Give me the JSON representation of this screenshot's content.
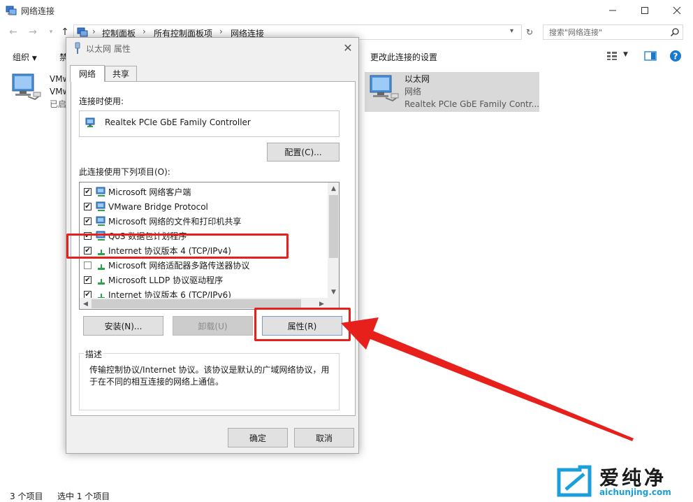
{
  "window": {
    "title": "网络连接"
  },
  "address": {
    "crumbs": [
      "控制面板",
      "所有控制面板项",
      "网络连接"
    ],
    "search_placeholder": "搜索\"网络连接\""
  },
  "commandbar": {
    "organize": "组织",
    "organize_partial": "禁",
    "change_settings": "更改此连接的设置"
  },
  "items": [
    {
      "line1": "VMw",
      "line2": "VMw",
      "line3": "已启"
    },
    {
      "line1": "以太网",
      "line2": "网络",
      "line3": "Realtek PCIe GbE Family Contr..."
    }
  ],
  "status": {
    "count": "3 个项目",
    "selected": "选中 1 个项目"
  },
  "dialog": {
    "title": "以太网 属性",
    "tabs": [
      "网络",
      "共享"
    ],
    "connect_using_label": "连接时使用:",
    "adapter_name": "Realtek PCIe GbE Family Controller",
    "configure_button": "配置(C)...",
    "items_label": "此连接使用下列项目(O):",
    "components": [
      {
        "label": "Microsoft 网络客户端",
        "checked": true,
        "icon": "network-client-icon"
      },
      {
        "label": "VMware Bridge Protocol",
        "checked": true,
        "icon": "network-client-icon"
      },
      {
        "label": "Microsoft 网络的文件和打印机共享",
        "checked": true,
        "icon": "network-client-icon"
      },
      {
        "label": "QoS 数据包计划程序",
        "checked": true,
        "icon": "network-client-icon"
      },
      {
        "label": "Internet 协议版本 4 (TCP/IPv4)",
        "checked": true,
        "icon": "protocol-icon"
      },
      {
        "label": "Microsoft 网络适配器多路传送器协议",
        "checked": false,
        "icon": "protocol-icon"
      },
      {
        "label": "Microsoft LLDP 协议驱动程序",
        "checked": true,
        "icon": "protocol-icon"
      },
      {
        "label": "Internet 协议版本 6 (TCP/IPv6)",
        "checked": true,
        "icon": "protocol-icon"
      }
    ],
    "install_button": "安装(N)...",
    "uninstall_button": "卸载(U)",
    "properties_button": "属性(R)",
    "description_title": "描述",
    "description_text": "传输控制协议/Internet 协议。该协议是默认的广域网络协议，用于在不同的相互连接的网络上通信。",
    "ok_button": "确定",
    "cancel_button": "取消"
  },
  "watermark": {
    "brand": "爱纯净",
    "url": "aichunjing.com"
  },
  "colors": {
    "annotation_red": "#e8201b",
    "selection_gray": "#d9d9d9",
    "help_blue": "#1979ca"
  }
}
